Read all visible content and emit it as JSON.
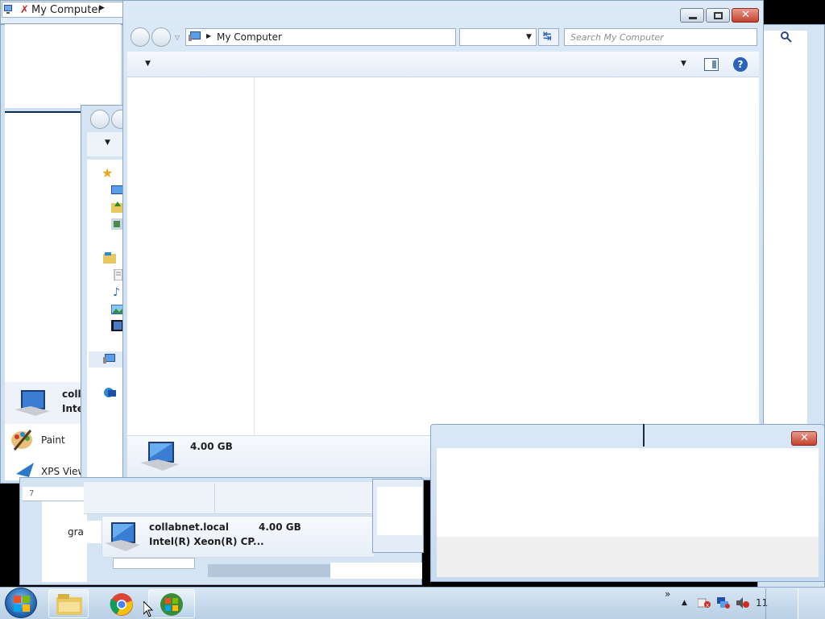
{
  "desktop": {
    "top_window_title": "My Computer",
    "main_window": {
      "address": "My Computer",
      "search_placeholder": "Search My Computer",
      "details": {
        "memory": "4.00 GB"
      }
    },
    "back_window": {
      "computer_name": "collabnet.local",
      "cpu": "Intel(R) Xeon(R) CP...",
      "memory": "4.00 GB",
      "partial_name": "coll",
      "partial_cpu": "Inte",
      "partial_path": "gra"
    },
    "start_menu_items": [
      {
        "label": "Paint",
        "icon": "paint-icon"
      },
      {
        "label": "XPS View",
        "icon": "xps-viewer-icon"
      }
    ],
    "partial_start_text": "7"
  },
  "taskbar": {
    "clock_partial": "11",
    "show_more": "»"
  },
  "colors": {
    "frame_blue": "#c4d9ee",
    "taskbar": "#c9dced",
    "close_red": "#c4412e"
  }
}
